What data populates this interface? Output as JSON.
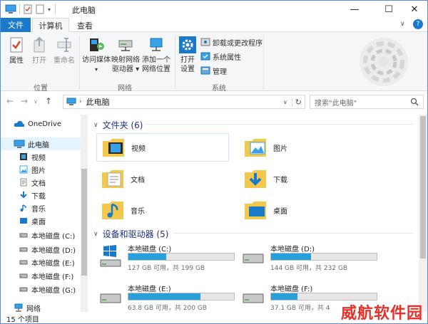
{
  "window": {
    "title": "此电脑",
    "controls": [
      "—",
      "☐",
      "✕"
    ]
  },
  "tabs": {
    "file": "文件",
    "items": [
      "计算机",
      "查看"
    ],
    "help": "?"
  },
  "ribbon": {
    "location_group": {
      "label": "位置",
      "buttons": [
        "属性",
        "打开",
        "重命名"
      ]
    },
    "network_group": {
      "label": "网络",
      "buttons": [
        {
          "line1": "访问媒体",
          "line2": "▾"
        },
        {
          "line1": "映射网络",
          "line2": "驱动器 ▾"
        },
        {
          "line1": "添加一个",
          "line2": "网络位置"
        }
      ]
    },
    "system_group": {
      "label": "系统",
      "settings_button": {
        "line1": "打开",
        "line2": "设置"
      },
      "items": [
        "卸载或更改程序",
        "系统属性",
        "管理"
      ]
    }
  },
  "navigation": {
    "address": "此电脑",
    "search_placeholder": "搜索\"此电脑\""
  },
  "sidebar": {
    "items": [
      {
        "label": "OneDrive",
        "icon": "onedrive-icon"
      },
      {
        "label": "此电脑",
        "icon": "computer-icon",
        "selected": true
      },
      {
        "label": "视频",
        "icon": "videos-folder-icon"
      },
      {
        "label": "图片",
        "icon": "pictures-folder-icon"
      },
      {
        "label": "文档",
        "icon": "documents-folder-icon"
      },
      {
        "label": "下载",
        "icon": "downloads-icon"
      },
      {
        "label": "音乐",
        "icon": "music-icon"
      },
      {
        "label": "桌面",
        "icon": "desktop-icon"
      },
      {
        "label": "本地磁盘 (C:)",
        "icon": "drive-icon"
      },
      {
        "label": "本地磁盘 (D:)",
        "icon": "drive-icon"
      },
      {
        "label": "本地磁盘 (E:)",
        "icon": "drive-icon"
      },
      {
        "label": "本地磁盘 (F:)",
        "icon": "drive-icon"
      },
      {
        "label": "本地磁盘 (G:)",
        "icon": "drive-icon"
      },
      {
        "label": "网络",
        "icon": "network-icon"
      }
    ]
  },
  "main": {
    "folders_header": "文件夹 (6)",
    "folders": [
      {
        "label": "视频",
        "icon": "videos-folder-icon"
      },
      {
        "label": "图片",
        "icon": "pictures-folder-icon"
      },
      {
        "label": "文档",
        "icon": "documents-folder-icon"
      },
      {
        "label": "下载",
        "icon": "downloads-folder-icon"
      },
      {
        "label": "音乐",
        "icon": "music-folder-icon"
      },
      {
        "label": "桌面",
        "icon": "desktop-folder-icon"
      }
    ],
    "drives_header": "设备和驱动器 (5)",
    "drives": [
      {
        "label": "本地磁盘 (C:)",
        "free": "127 GB 可用，共 199 GB",
        "used_fraction": 0.36
      },
      {
        "label": "本地磁盘 (D:)",
        "free": "144 GB 可用，共 232 GB",
        "used_fraction": 0.38
      },
      {
        "label": "本地磁盘 (E:)",
        "free": "63.8 GB 可用，共 200 GB",
        "used_fraction": 0.68
      },
      {
        "label": "本地磁盘 (F:)",
        "free": "37.1 GB 可用，共 4",
        "used_fraction": 0.25
      }
    ]
  },
  "status": {
    "count": "15 个项目"
  },
  "watermark": "威航软件园",
  "colors": {
    "accent": "#1979ca",
    "drive_bar": "#26a0da",
    "folder_yellow": "#f2c94c",
    "watermark": "#e8302b"
  }
}
